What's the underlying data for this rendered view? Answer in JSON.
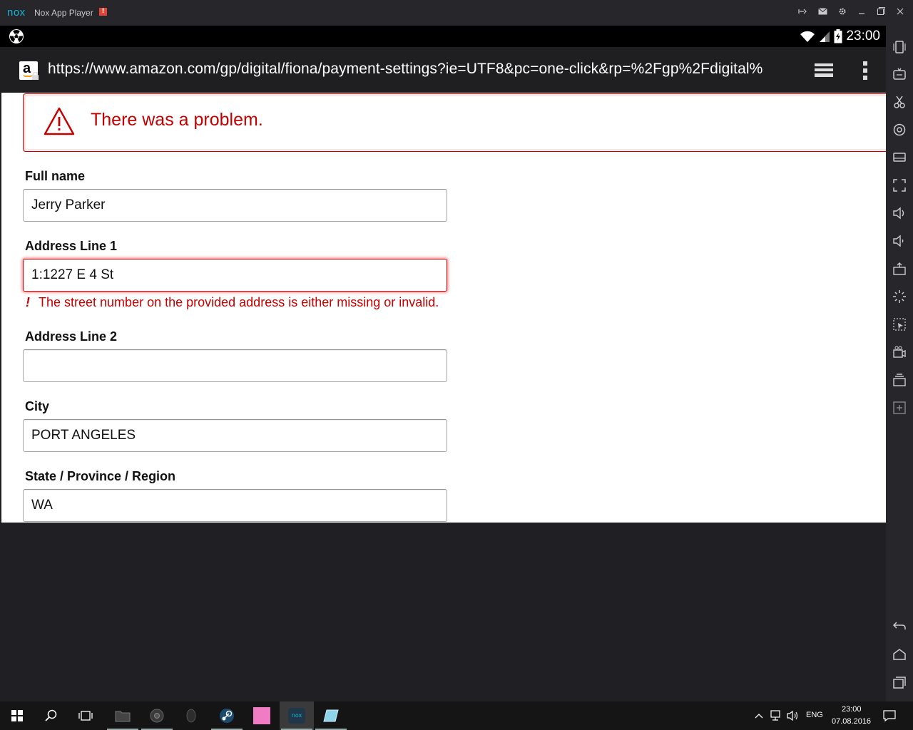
{
  "window": {
    "logo_text": "nox",
    "title": "Nox App Player",
    "warning_badge": "!"
  },
  "status_bar": {
    "time": "23:00"
  },
  "browser": {
    "url": "https://www.amazon.com/gp/digital/fiona/payment-settings?ie=UTF8&pc=one-click&rp=%2Fgp%2Fdigital%",
    "favicon_letter": "a"
  },
  "page": {
    "alert_message": "There was a problem.",
    "form": {
      "full_name": {
        "label": "Full name",
        "value": "Jerry Parker"
      },
      "address_line_1": {
        "label": "Address Line 1",
        "value": "1:1227 E 4 St",
        "error_mark": "!",
        "error": "The street number on the provided address is either missing or invalid."
      },
      "address_line_2": {
        "label": "Address Line 2",
        "value": ""
      },
      "city": {
        "label": "City",
        "value": "PORT ANGELES"
      },
      "state": {
        "label": "State / Province / Region",
        "value": "WA"
      }
    }
  },
  "taskbar": {
    "language": "ENG",
    "time": "23:00",
    "date": "07.08.2016"
  },
  "colors": {
    "error_red": "#c40000",
    "nox_blue": "#19b3d6"
  }
}
